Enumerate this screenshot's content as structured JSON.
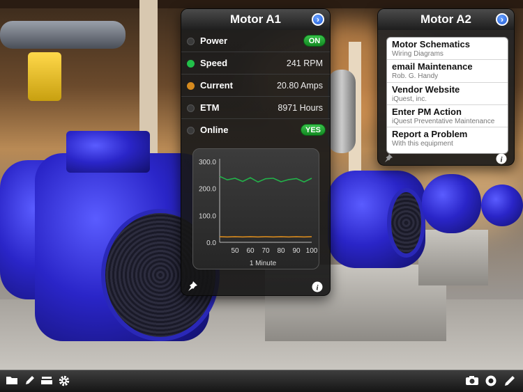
{
  "panel_a1": {
    "title": "Motor A1",
    "rows": [
      {
        "label": "Power",
        "status_color": "#3a3a3a",
        "value": "ON",
        "type": "toggle"
      },
      {
        "label": "Speed",
        "status_color": "#22c04a",
        "value": "241 RPM",
        "type": "text"
      },
      {
        "label": "Current",
        "status_color": "#d68a1e",
        "value": "20.80 Amps",
        "type": "text"
      },
      {
        "label": "ETM",
        "status_color": "#3a3a3a",
        "value": "8971 Hours",
        "type": "text"
      },
      {
        "label": "Online",
        "status_color": "#3a3a3a",
        "value": "YES",
        "type": "toggle"
      }
    ],
    "pin_icon": "pushpin-icon",
    "info_icon": "info-icon"
  },
  "chart_data": {
    "type": "line",
    "x": [
      40,
      45,
      50,
      55,
      60,
      65,
      70,
      75,
      80,
      85,
      90,
      95,
      100
    ],
    "series": [
      {
        "color": "#23b24a",
        "values": [
          245,
          232,
          238,
          226,
          240,
          224,
          236,
          238,
          225,
          233,
          237,
          224,
          238
        ]
      },
      {
        "color": "#d68a1e",
        "values": [
          21,
          20,
          21,
          20,
          21,
          20,
          21,
          20,
          21,
          20,
          21,
          20,
          21
        ]
      }
    ],
    "ylim": [
      0,
      300
    ],
    "xlim": [
      40,
      100
    ],
    "y_ticks": [
      "300.0",
      "200.0",
      "100.0",
      "0.0"
    ],
    "x_ticks": [
      "50",
      "60",
      "70",
      "80",
      "90",
      "100"
    ],
    "xlabel": "1 Minute",
    "grid": false
  },
  "panel_a2": {
    "title": "Motor A2",
    "items": [
      {
        "title": "Motor Schematics",
        "subtitle": "Wiring Diagrams"
      },
      {
        "title": "email Maintenance",
        "subtitle": "Rob. G. Handy"
      },
      {
        "title": "Vendor Website",
        "subtitle": "iQuest, inc."
      },
      {
        "title": "Enter PM Action",
        "subtitle": "iQuest Preventative Maintenance"
      },
      {
        "title": "Report a Problem",
        "subtitle": "With this equipment"
      }
    ]
  },
  "toolbar": {
    "left_icons": [
      "folder-icon",
      "pencil-icon",
      "tray-icon",
      "gear-icon"
    ],
    "right_icons": [
      "camera-icon",
      "record-icon",
      "pen-icon"
    ]
  }
}
